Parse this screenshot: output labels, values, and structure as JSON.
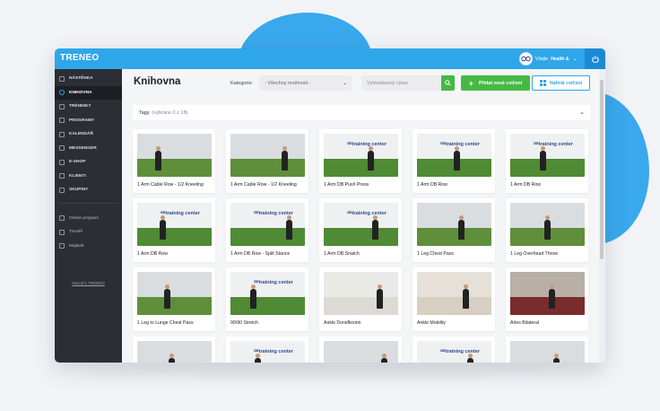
{
  "app": {
    "logo": "TRENEO"
  },
  "user": {
    "greeting": "Vítejte",
    "name": "Health &"
  },
  "sidebar": {
    "items": [
      {
        "label": "Nástěnka",
        "icon": "dashboard-icon",
        "active": false
      },
      {
        "label": "Knihovna",
        "icon": "library-icon",
        "active": true
      },
      {
        "label": "Tréninky",
        "icon": "dumbbell-icon",
        "active": false
      },
      {
        "label": "Programy",
        "icon": "programs-icon",
        "active": false
      },
      {
        "label": "Kalendář",
        "icon": "calendar-icon",
        "active": false
      },
      {
        "label": "Messenger",
        "icon": "chat-icon",
        "active": false
      },
      {
        "label": "E-shop",
        "icon": "cart-icon",
        "active": false
      },
      {
        "label": "Klienti",
        "icon": "clients-icon",
        "active": false
      },
      {
        "label": "Skupiny",
        "icon": "groups-icon",
        "active": false
      }
    ],
    "secondary": [
      {
        "label": "Online program",
        "icon": "online-icon"
      },
      {
        "label": "Trenéři",
        "icon": "trainers-icon"
      },
      {
        "label": "Majitelé",
        "icon": "owners-icon"
      }
    ],
    "guide_link": "Návod k TRENEO"
  },
  "header": {
    "title": "Knihovna",
    "category_label": "Kategorie:",
    "category_value": "- Všechny možnosti -",
    "search_placeholder": "Vyhledávaný výraz",
    "add_button": "Přidat nové cvičení",
    "load_button": "Nahrát cvičení"
  },
  "tags": {
    "label": "Tagy",
    "selected": "(vybráno 0 z 18)"
  },
  "exercises": [
    {
      "title": "1 Arm Cable Row - 1/2 Kneeling",
      "scene": "gym"
    },
    {
      "title": "1 Arm Cable Row - 1/2 Kneeling",
      "scene": "gym"
    },
    {
      "title": "1 Arm DB Push Press",
      "scene": "studio"
    },
    {
      "title": "1 Arm DB Row",
      "scene": "studio"
    },
    {
      "title": "1 Arm DB Row",
      "scene": "studio"
    },
    {
      "title": "1 Arm DB Row",
      "scene": "studio"
    },
    {
      "title": "1 Arm DB Row - Split Stance",
      "scene": "studio"
    },
    {
      "title": "1 Arm DB Snatch",
      "scene": "studio"
    },
    {
      "title": "1 Leg Chest Pass",
      "scene": "gym"
    },
    {
      "title": "1 Leg Overhead Throw",
      "scene": "gym"
    },
    {
      "title": "1 Leg to Lunge Chest Pass",
      "scene": "gym"
    },
    {
      "title": "90/90 Stretch",
      "scene": "studio"
    },
    {
      "title": "Ankle Dorsiflexion",
      "scene": "plain"
    },
    {
      "title": "Ankle Mobility",
      "scene": "room"
    },
    {
      "title": "Arles Bilateral",
      "scene": "crossfit"
    },
    {
      "title": "",
      "scene": "gym"
    },
    {
      "title": "",
      "scene": "studio"
    },
    {
      "title": "",
      "scene": "gym"
    },
    {
      "title": "",
      "scene": "studio"
    },
    {
      "title": "",
      "scene": "gym"
    }
  ],
  "brand_overlay": {
    "line1": "health",
    "line2": "training center"
  },
  "colors": {
    "accent": "#2fa6ea",
    "green": "#46b944",
    "sidebar": "#2b2f35"
  }
}
